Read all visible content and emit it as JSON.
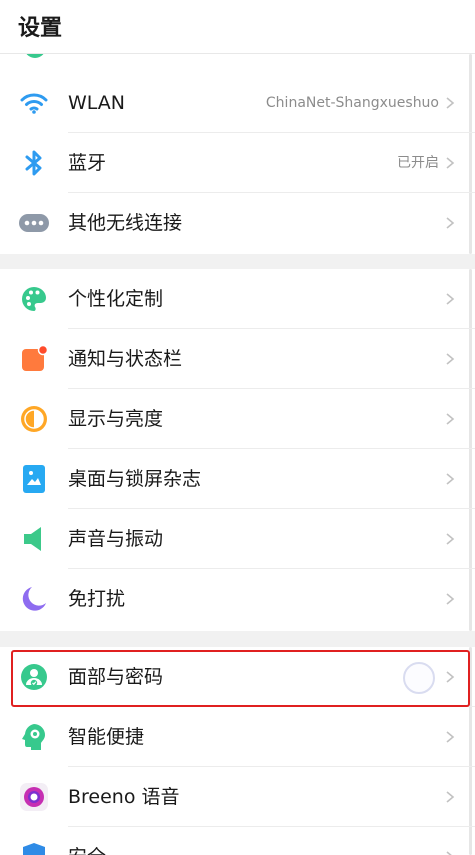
{
  "header": {
    "title": "设置"
  },
  "groups": [
    {
      "items": [
        {
          "label": "WLAN",
          "value": "ChinaNet-Shangxueshuo",
          "icon": "wifi-icon"
        },
        {
          "label": "蓝牙",
          "value": "已开启",
          "icon": "bluetooth-icon"
        },
        {
          "label": "其他无线连接",
          "value": "",
          "icon": "more-connections-icon"
        }
      ]
    },
    {
      "items": [
        {
          "label": "个性化定制",
          "icon": "palette-icon"
        },
        {
          "label": "通知与状态栏",
          "icon": "notification-icon"
        },
        {
          "label": "显示与亮度",
          "icon": "brightness-icon"
        },
        {
          "label": "桌面与锁屏杂志",
          "icon": "wallpaper-icon"
        },
        {
          "label": "声音与振动",
          "icon": "sound-icon"
        },
        {
          "label": "免打扰",
          "icon": "moon-icon"
        }
      ]
    },
    {
      "items": [
        {
          "label": "面部与密码",
          "icon": "face-password-icon",
          "highlighted": true
        },
        {
          "label": "智能便捷",
          "icon": "smart-assist-icon"
        },
        {
          "label": "Breeno 语音",
          "icon": "breeno-icon"
        },
        {
          "label": "安全",
          "icon": "security-icon"
        }
      ]
    }
  ],
  "colors": {
    "wifi": "#2e9bf0",
    "bluetooth": "#2e9bf0",
    "more": "#8e99a8",
    "palette": "#37c98d",
    "notification": "#ff7a3d",
    "brightness": "#ffa726",
    "wallpaper": "#27a9f2",
    "sound": "#3cc98a",
    "moon": "#8e6cf0",
    "face": "#37c98d",
    "smart": "#37c98d",
    "breeno": "#c62fb2",
    "security": "#2f8be6",
    "highlight_border": "#e02020"
  }
}
